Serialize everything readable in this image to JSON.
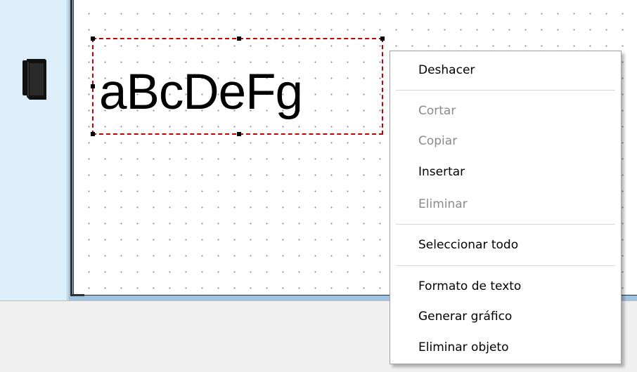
{
  "canvas": {
    "text_object": {
      "text": "aBcDeFg"
    }
  },
  "context_menu": {
    "items": [
      {
        "label": "Deshacer",
        "enabled": true
      },
      {
        "label": "Cortar",
        "enabled": false
      },
      {
        "label": "Copiar",
        "enabled": false
      },
      {
        "label": "Insertar",
        "enabled": true
      },
      {
        "label": "Eliminar",
        "enabled": false
      },
      {
        "label": "Seleccionar todo",
        "enabled": true
      },
      {
        "label": "Formato de texto",
        "enabled": true
      },
      {
        "label": "Generar gráfico",
        "enabled": true
      },
      {
        "label": "Eliminar objeto",
        "enabled": true
      }
    ]
  },
  "icons": {
    "left_strip_tool": "label-printer-icon"
  },
  "colors": {
    "selection_border": "#c00000",
    "left_strip": "#ddeefb",
    "canvas_frame": "#9fc3e0",
    "disabled_text": "#8a8a8a"
  }
}
